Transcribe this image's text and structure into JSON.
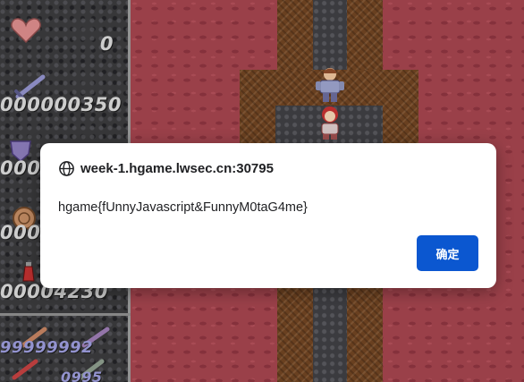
{
  "game": {
    "stats": {
      "hearts": "0",
      "attack": "000000350",
      "defense": "000",
      "gold": "000",
      "potions": "00004230",
      "keys_row1": "99999992",
      "keys_row2": "0995"
    }
  },
  "dialog": {
    "host": "week-1.hgame.lwsec.cn:30795",
    "message": "hgame{fUnnyJavascript&FunnyM0taG4me}",
    "ok_label": "确定"
  }
}
